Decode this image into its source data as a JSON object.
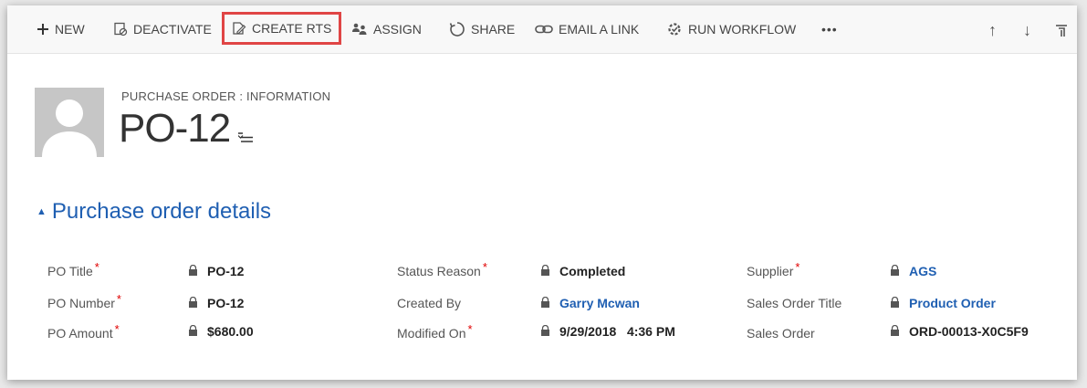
{
  "toolbar": {
    "new": "NEW",
    "deactivate": "DEACTIVATE",
    "create_rts": "CREATE RTS",
    "assign": "ASSIGN",
    "share": "SHARE",
    "email_link": "EMAIL A LINK",
    "run_workflow": "RUN WORKFLOW",
    "more": "•••",
    "up": "↑",
    "down": "↓"
  },
  "header": {
    "entity_type": "PURCHASE ORDER : INFORMATION",
    "record_title": "PO-12"
  },
  "section": {
    "title": "Purchase order details"
  },
  "fields": {
    "po_title": {
      "label": "PO Title",
      "value": "PO-12"
    },
    "po_number": {
      "label": "PO Number",
      "value": "PO-12"
    },
    "po_amount": {
      "label": "PO Amount",
      "value": "$680.00"
    },
    "status_reason": {
      "label": "Status Reason",
      "value": "Completed"
    },
    "created_by": {
      "label": "Created By",
      "value": "Garry Mcwan"
    },
    "modified_on": {
      "label": "Modified On",
      "value": "9/29/2018   4:36 PM"
    },
    "supplier": {
      "label": "Supplier",
      "value": "AGS"
    },
    "sales_order_title": {
      "label": "Sales Order Title",
      "value": "Product Order"
    },
    "sales_order": {
      "label": "Sales Order",
      "value": "ORD-00013-X0C5F9"
    }
  },
  "required_mark": "*",
  "colors": {
    "link": "#1f5fb2",
    "required": "#e00000",
    "highlight": "#e04545"
  }
}
